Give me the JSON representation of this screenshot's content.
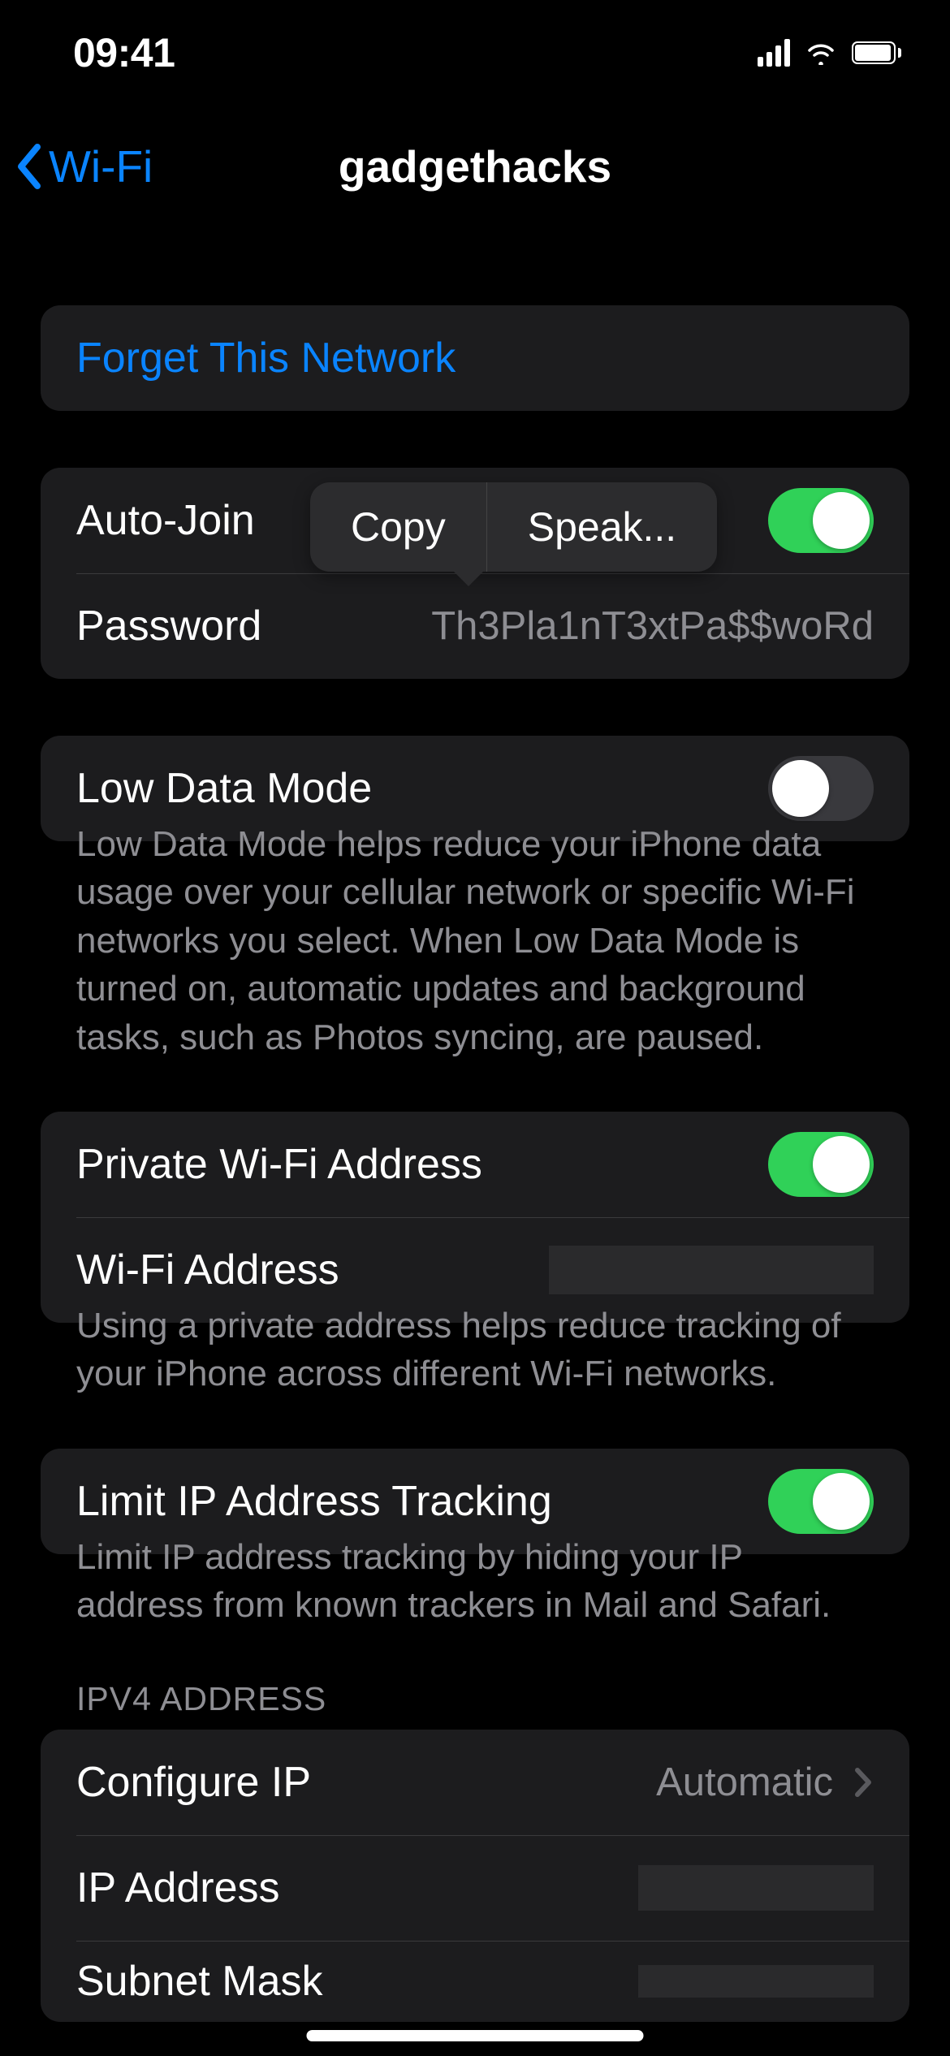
{
  "status": {
    "time": "09:41"
  },
  "nav": {
    "back_label": "Wi-Fi",
    "title": "gadgethacks"
  },
  "forget": {
    "label": "Forget This Network"
  },
  "autojoin": {
    "label": "Auto-Join",
    "enabled": true
  },
  "password": {
    "label": "Password",
    "value": "Th3Pla1nT3xtPa$$woRd"
  },
  "context_menu": {
    "copy": "Copy",
    "speak": "Speak..."
  },
  "lowdata": {
    "label": "Low Data Mode",
    "enabled": false,
    "footer": "Low Data Mode helps reduce your iPhone data usage over your cellular network or specific Wi-Fi networks you select. When Low Data Mode is turned on, automatic updates and background tasks, such as Photos syncing, are paused."
  },
  "private_addr": {
    "label": "Private Wi-Fi Address",
    "enabled": true,
    "address_label": "Wi-Fi Address",
    "footer": "Using a private address helps reduce tracking of your iPhone across different Wi-Fi networks."
  },
  "limit_ip": {
    "label": "Limit IP Address Tracking",
    "enabled": true,
    "footer": "Limit IP address tracking by hiding your IP address from known trackers in Mail and Safari."
  },
  "ipv4": {
    "header": "IPV4 ADDRESS",
    "configure_label": "Configure IP",
    "configure_value": "Automatic",
    "ip_label": "IP Address",
    "subnet_label": "Subnet Mask"
  }
}
